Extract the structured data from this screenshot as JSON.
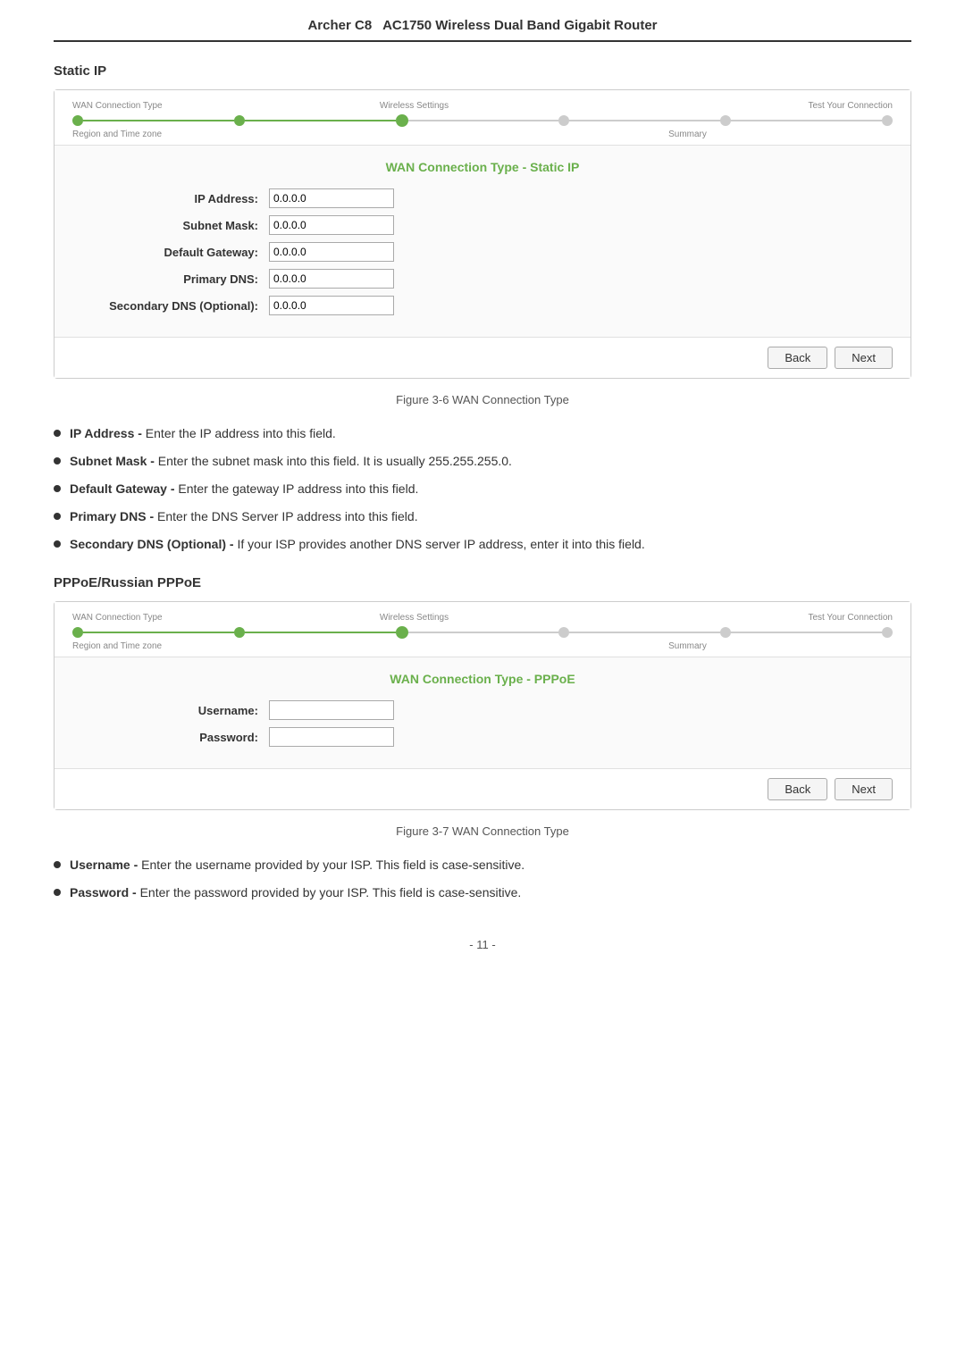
{
  "header": {
    "product": "Archer C8",
    "title": "AC1750 Wireless Dual Band Gigabit Router"
  },
  "section1": {
    "heading": "Static IP",
    "wizard": {
      "steps": [
        {
          "label": "WAN Connection Type",
          "state": "completed"
        },
        {
          "label": "",
          "state": "completed"
        },
        {
          "label": "Wireless Settings",
          "state": "active"
        },
        {
          "label": "",
          "state": "inactive"
        },
        {
          "label": "",
          "state": "inactive"
        },
        {
          "label": "Test Your Connection",
          "state": "inactive"
        }
      ],
      "step_labels_top": [
        "WAN Connection Type",
        "",
        "Wireless Settings",
        "",
        "",
        "Test Your Connection"
      ],
      "step_labels_bottom": [
        "Region and Time zone",
        "",
        "",
        "",
        "Summary",
        ""
      ],
      "subtitle": "WAN Connection Type - Static IP",
      "fields": [
        {
          "label": "IP Address:",
          "value": "0.0.0.0"
        },
        {
          "label": "Subnet Mask:",
          "value": "0.0.0.0"
        },
        {
          "label": "Default Gateway:",
          "value": "0.0.0.0"
        },
        {
          "label": "Primary DNS:",
          "value": "0.0.0.0"
        },
        {
          "label": "Secondary DNS (Optional):",
          "value": "0.0.0.0"
        }
      ],
      "back_label": "Back",
      "next_label": "Next"
    },
    "caption": "Figure 3-6 WAN Connection Type",
    "bullets": [
      {
        "bold": "IP Address -",
        "text": " Enter the IP address into this field."
      },
      {
        "bold": "Subnet Mask -",
        "text": " Enter the subnet mask into this field. It is usually 255.255.255.0."
      },
      {
        "bold": "Default Gateway -",
        "text": " Enter the gateway IP address into this field."
      },
      {
        "bold": "Primary DNS -",
        "text": " Enter the DNS Server IP address into this field."
      },
      {
        "bold": "Secondary DNS (Optional) -",
        "text": " If your ISP provides another DNS server IP address, enter it into this field."
      }
    ]
  },
  "section2": {
    "heading": "PPPoE/Russian PPPoE",
    "wizard": {
      "subtitle": "WAN Connection Type - PPPoE",
      "fields": [
        {
          "label": "Username:",
          "value": ""
        },
        {
          "label": "Password:",
          "value": ""
        }
      ],
      "back_label": "Back",
      "next_label": "Next"
    },
    "caption": "Figure 3-7 WAN Connection Type",
    "bullets": [
      {
        "bold": "Username -",
        "text": " Enter the username provided by your ISP. This field is case-sensitive."
      },
      {
        "bold": "Password -",
        "text": " Enter the password provided by your ISP. This field is case-sensitive."
      }
    ]
  },
  "page_number": "- 11 -"
}
